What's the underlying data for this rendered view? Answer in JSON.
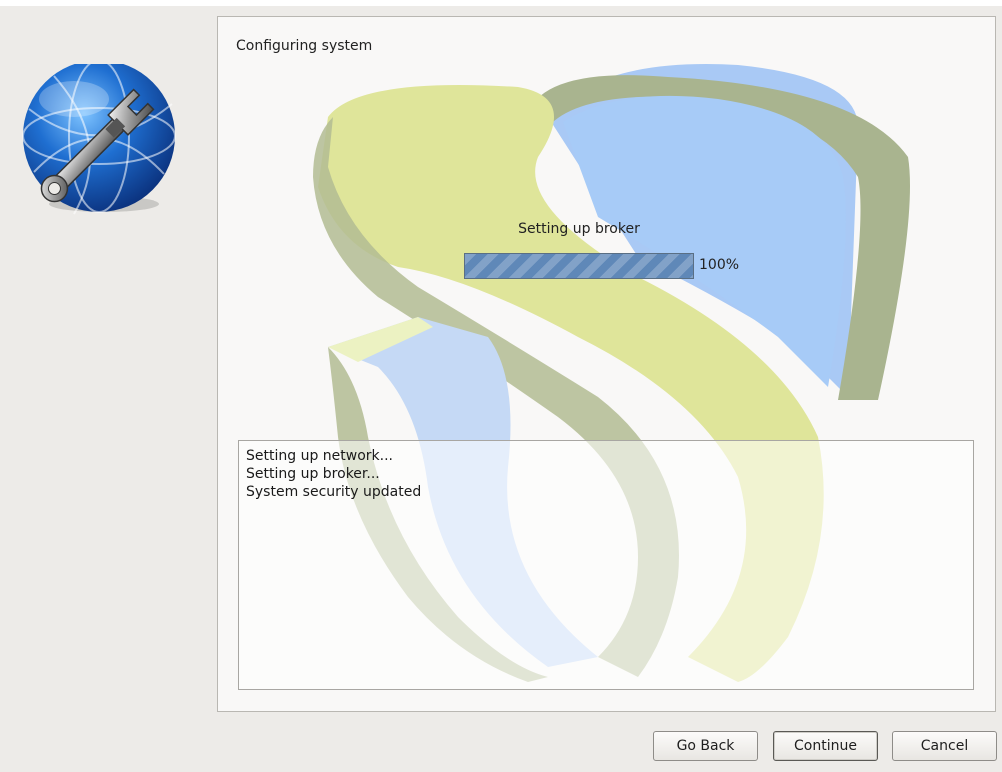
{
  "window": {
    "panel_title": "Configuring system"
  },
  "progress": {
    "label": "Setting up broker",
    "percent_text": "100%",
    "value": 1.0
  },
  "log": {
    "lines": [
      "Setting up network...",
      "Setting up broker...",
      "System security updated"
    ]
  },
  "buttons": {
    "back_label": "Go Back",
    "continue_label": "Continue",
    "cancel_label": "Cancel"
  },
  "icons": {
    "app_icon": "globe-wrench-icon",
    "watermark": "uds-logo-watermark"
  },
  "colors": {
    "progress_fill": "#5f88b8",
    "watermark_yellow": "#dfe59a",
    "watermark_blue": "#a9c9f5",
    "watermark_olive": "#a9b48f"
  }
}
